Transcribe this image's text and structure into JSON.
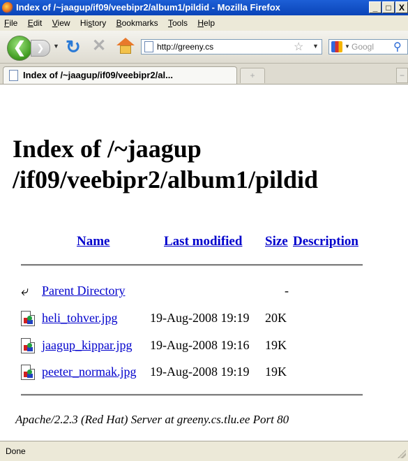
{
  "window": {
    "title": "Index of /~jaagup/if09/veebipr2/album1/pildid - Mozilla Firefox",
    "min_glyph": "_",
    "max_glyph": "□",
    "close_glyph": "X"
  },
  "menu": {
    "items": [
      "File",
      "Edit",
      "View",
      "History",
      "Bookmarks",
      "Tools",
      "Help"
    ],
    "underline": [
      "F",
      "E",
      "V",
      "s",
      "B",
      "T",
      "H"
    ]
  },
  "navbar": {
    "url": "http://greeny.cs",
    "search_placeholder": "Googl"
  },
  "tab": {
    "label": "Index of /~jaagup/if09/veebipr2/al...",
    "new_tab_glyph": "+"
  },
  "page": {
    "heading": "Index of /~jaagup /if09/veebipr2/album1/pildid",
    "columns": {
      "name": "Name",
      "last_modified": "Last modified",
      "size": "Size",
      "description": "Description"
    },
    "parent": {
      "name": "Parent Directory",
      "size": "-"
    },
    "files": [
      {
        "name": "heli_tohver.jpg",
        "modified": "19-Aug-2008 19:19",
        "size": "20K"
      },
      {
        "name": "jaagup_kippar.jpg",
        "modified": "19-Aug-2008 19:16",
        "size": "19K"
      },
      {
        "name": "peeter_normak.jpg",
        "modified": "19-Aug-2008 19:19",
        "size": "19K"
      }
    ],
    "footer": "Apache/2.2.3 (Red Hat) Server at greeny.cs.tlu.ee Port 80"
  },
  "status": {
    "text": "Done"
  },
  "icons": {
    "back": "back-arrow-icon",
    "forward": "forward-arrow-icon",
    "reload": "reload-icon",
    "stop": "stop-icon",
    "home": "home-icon",
    "bookmark": "star-icon",
    "search": "magnifier-icon",
    "parent": "back-arrow-icon",
    "file": "image-file-icon"
  }
}
